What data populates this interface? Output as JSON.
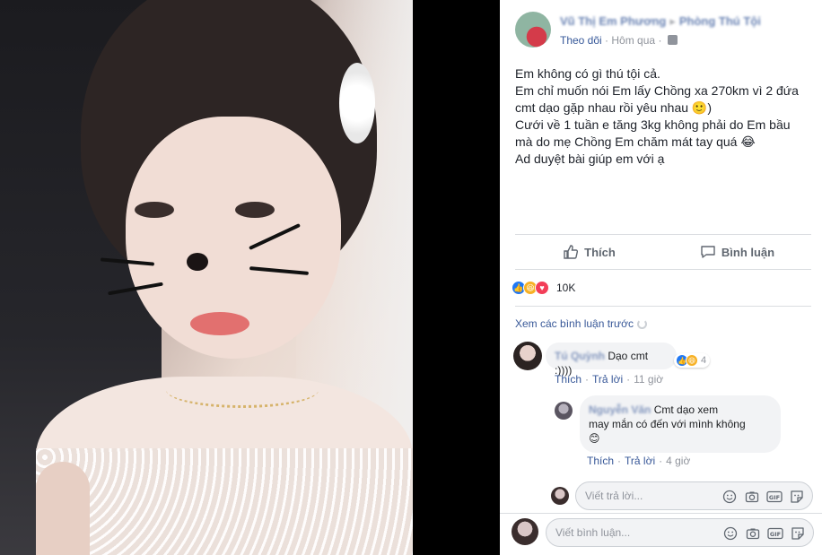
{
  "post": {
    "author_name": "Vũ Thị Em Phương",
    "group_name": "Phòng Thú Tội",
    "follow_label": "Theo dõi",
    "time": "Hôm qua",
    "text_lines": [
      "Em không có gì thú tội cả.",
      "Em chỉ muốn nói Em lấy Chồng xa 270km vì 2 đứa",
      "cmt dạo gặp nhau rồi yêu nhau 🙂)",
      "Cưới về 1 tuần e tăng 3kg không phải do Em bầu",
      "mà do mẹ Chồng Em chăm mát tay quá 😂",
      "Ad duyệt bài giúp em với ạ"
    ]
  },
  "actions": {
    "like_label": "Thích",
    "comment_label": "Bình luận"
  },
  "reactions": {
    "count": "10K"
  },
  "comments": {
    "view_previous": "Xem các bình luận trước",
    "items": [
      {
        "author": "Tú Quỳnh",
        "text": "Dạo cmt :))))",
        "like_label": "Thích",
        "reply_label": "Trả lời",
        "time": "11 giờ",
        "reaction_count": "4"
      }
    ],
    "reply": {
      "author": "Nguyễn Văn",
      "text_line1": "Cmt dạo xem",
      "text_line2": "may mắn có đến với mình không",
      "emoji": "😊",
      "like_label": "Thích",
      "reply_label": "Trả lời",
      "time": "4 giờ"
    },
    "reply_placeholder": "Viết trả lời...",
    "comment_placeholder": "Viết bình luận..."
  },
  "icons": {
    "emoji": "smiley-icon",
    "camera": "camera-icon",
    "gif": "gif-icon",
    "sticker": "sticker-icon"
  }
}
